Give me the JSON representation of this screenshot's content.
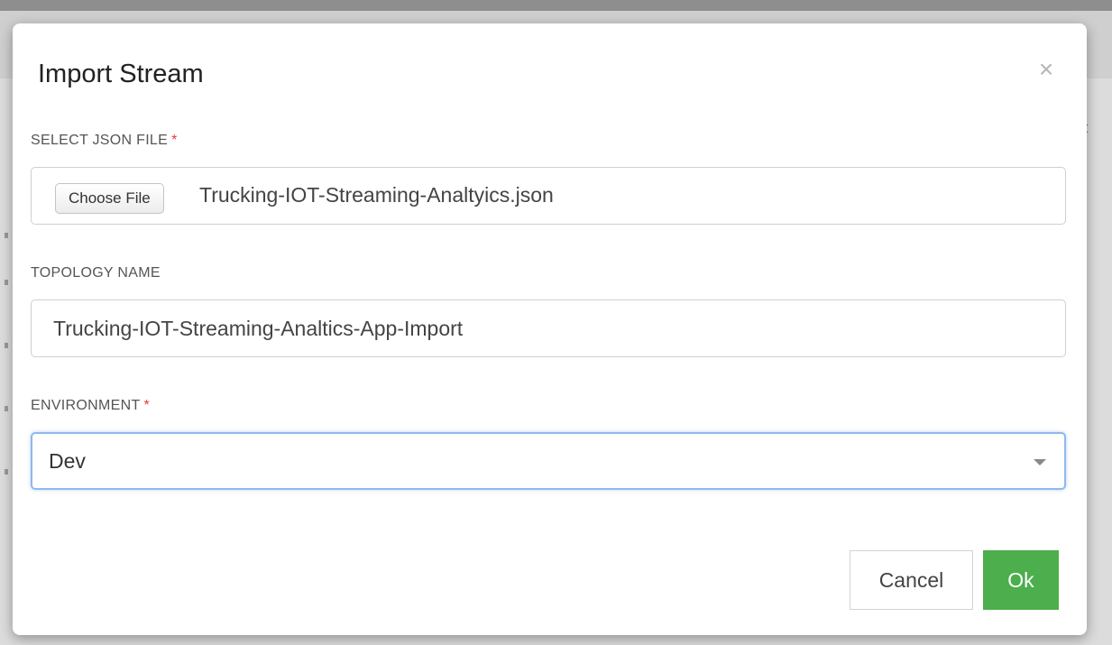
{
  "background": {
    "partial_text": "rt"
  },
  "dialog": {
    "title": "Import Stream",
    "close_icon": "close-icon",
    "close_glyph": "×",
    "fields": {
      "json_file": {
        "label": "SELECT JSON FILE",
        "required_marker": "*",
        "button_label": "Choose File",
        "file_name": "Trucking-IOT-Streaming-Analtyics.json"
      },
      "topology_name": {
        "label": "TOPOLOGY NAME",
        "value": "Trucking-IOT-Streaming-Analtics-App-Import"
      },
      "environment": {
        "label": "ENVIRONMENT",
        "required_marker": "*",
        "selected": "Dev",
        "dropdown_icon": "caret-down-icon"
      }
    },
    "buttons": {
      "cancel": "Cancel",
      "ok": "Ok"
    }
  },
  "colors": {
    "ok_button": "#4cae4c",
    "required_marker": "#e53935",
    "focus_border": "#90b8ec"
  }
}
